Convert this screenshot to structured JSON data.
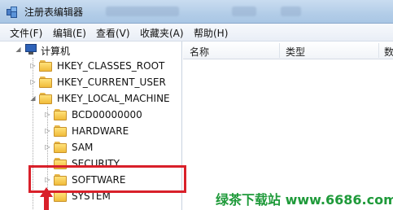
{
  "window": {
    "title": "注册表编辑器"
  },
  "menu": [
    "文件(F)",
    "编辑(E)",
    "查看(V)",
    "收藏夹(A)",
    "帮助(H)"
  ],
  "columns": [
    "名称",
    "类型",
    "数"
  ],
  "tree": {
    "root": "计算机",
    "hives": [
      "HKEY_CLASSES_ROOT",
      "HKEY_CURRENT_USER",
      "HKEY_LOCAL_MACHINE"
    ],
    "hklm_children": [
      "BCD00000000",
      "HARDWARE",
      "SAM",
      "SECURITY",
      "SOFTWARE",
      "SYSTEM"
    ]
  },
  "watermark": {
    "name": "绿茶下载站",
    "url": "www.6686.com"
  },
  "colors": {
    "highlight": "#d9202a",
    "watermark": "#1f9a3a"
  },
  "icons": {
    "expanded": "triangle-down-right",
    "collapsed": "triangle-right",
    "folder": "folder-icon",
    "computer": "computer-icon"
  }
}
